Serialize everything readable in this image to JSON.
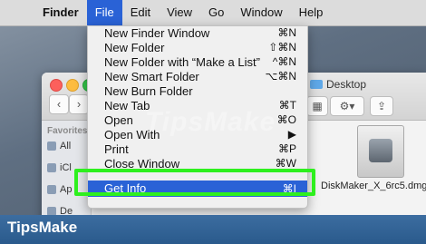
{
  "menubar": {
    "items": [
      "Finder",
      "File",
      "Edit",
      "View",
      "Go",
      "Window",
      "Help"
    ],
    "active": "File"
  },
  "file_menu": [
    {
      "label": "New Finder Window",
      "shortcut": "⌘N"
    },
    {
      "label": "New Folder",
      "shortcut": "⇧⌘N"
    },
    {
      "label": "New Folder with “Make a List”",
      "shortcut": "^⌘N"
    },
    {
      "label": "New Smart Folder",
      "shortcut": "⌥⌘N"
    },
    {
      "label": "New Burn Folder",
      "shortcut": ""
    },
    {
      "label": "New Tab",
      "shortcut": "⌘T"
    },
    {
      "label": "Open",
      "shortcut": "⌘O"
    },
    {
      "label": "Open With",
      "shortcut": "▶"
    },
    {
      "label": "Print",
      "shortcut": "⌘P"
    },
    {
      "label": "Close Window",
      "shortcut": "⌘W"
    },
    {
      "label": "Get Info",
      "shortcut": "⌘I"
    }
  ],
  "finder": {
    "title": "Desktop",
    "sidebar_heading": "Favorites",
    "sidebar_items": [
      "All",
      "iCl",
      "Ap",
      "De"
    ],
    "file_name": "DiskMaker_X_6rc5.dmg"
  },
  "watermark": "TipsMake",
  "brand": "TipsMake",
  "colors": {
    "menu_highlight": "#2a62d6",
    "callout_border": "#2ef01e",
    "brand_bar": "#2a5a8c"
  }
}
